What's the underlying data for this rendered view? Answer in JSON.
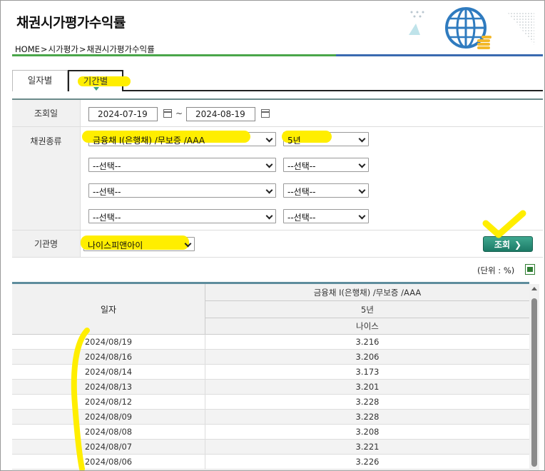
{
  "page": {
    "title": "채권시가평가수익률",
    "breadcrumb": [
      "HOME",
      ">",
      "시가평가",
      ">",
      "채권시가평가수익률"
    ]
  },
  "tabs": [
    {
      "label": "일자별",
      "active": false
    },
    {
      "label": "기간별",
      "active": true
    }
  ],
  "form": {
    "date_label": "조회일",
    "date_from": "2024-07-19",
    "date_sep": "~",
    "date_to": "2024-08-19",
    "bond_type_label": "채권종류",
    "bond_rows": [
      {
        "type": "금융채 I(은행채) /무보증 /AAA",
        "term": "5년"
      },
      {
        "type": "--선택--",
        "term": "--선택--"
      },
      {
        "type": "--선택--",
        "term": "--선택--"
      },
      {
        "type": "--선택--",
        "term": "--선택--"
      }
    ],
    "org_label": "기관명",
    "org_value": "나이스피앤아이",
    "query_button": "조회",
    "query_arrow": "❯"
  },
  "unit_text": "(단위 : %)",
  "table": {
    "col_date_header": "일자",
    "header_bond": "금융채 I(은행채) /무보증 /AAA",
    "header_term": "5년",
    "header_org": "나이스",
    "rows": [
      {
        "date": "2024/08/19",
        "value": "3.216"
      },
      {
        "date": "2024/08/16",
        "value": "3.206"
      },
      {
        "date": "2024/08/14",
        "value": "3.173"
      },
      {
        "date": "2024/08/13",
        "value": "3.201"
      },
      {
        "date": "2024/08/12",
        "value": "3.228"
      },
      {
        "date": "2024/08/09",
        "value": "3.228"
      },
      {
        "date": "2024/08/08",
        "value": "3.208"
      },
      {
        "date": "2024/08/07",
        "value": "3.221"
      },
      {
        "date": "2024/08/06",
        "value": "3.226"
      }
    ]
  },
  "colors": {
    "highlight": "#ffee00",
    "query_button": "#2a8c75",
    "green_rule": "#4aa64a",
    "blue_rule": "#3a6ab0"
  }
}
